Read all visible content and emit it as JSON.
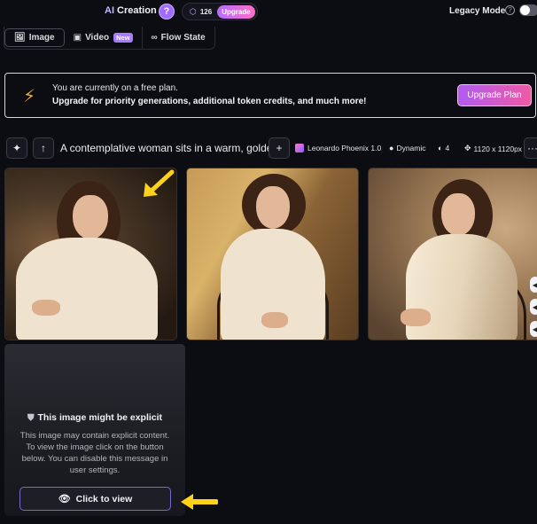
{
  "header": {
    "title_prefix": "AI",
    "title_rest": " Creation",
    "help_glyph": "?",
    "tokens": "126",
    "upgrade_badge": "Upgrade",
    "legacy_mode": "Legacy Mode",
    "legacy_help": "?"
  },
  "tabs": [
    {
      "label": "Image",
      "active": true
    },
    {
      "label": "Video",
      "badge": "New"
    },
    {
      "label": "Flow State"
    }
  ],
  "banner": {
    "line1": "You are currently on a free plan.",
    "line2": "Upgrade for priority generations, additional token credits, and much more!",
    "button": "Upgrade Plan"
  },
  "prompt": {
    "text": "A contemplative woman sits in a warm, golde...",
    "model": "Leonardo Phoenix 1.0",
    "style": "Dynamic",
    "count": "4",
    "size": "1120 x 1120px"
  },
  "explicit": {
    "title": "This image might be explicit",
    "body": "This image may contain explicit content. To view the image click on the button below. You can disable this message in user settings.",
    "button": "Click to view"
  },
  "colors": {
    "background": "#0c0d12",
    "accent_gradient_start": "#b05cf0",
    "accent_gradient_end": "#ef5aa4",
    "annotation_arrow": "#ffd21a"
  }
}
